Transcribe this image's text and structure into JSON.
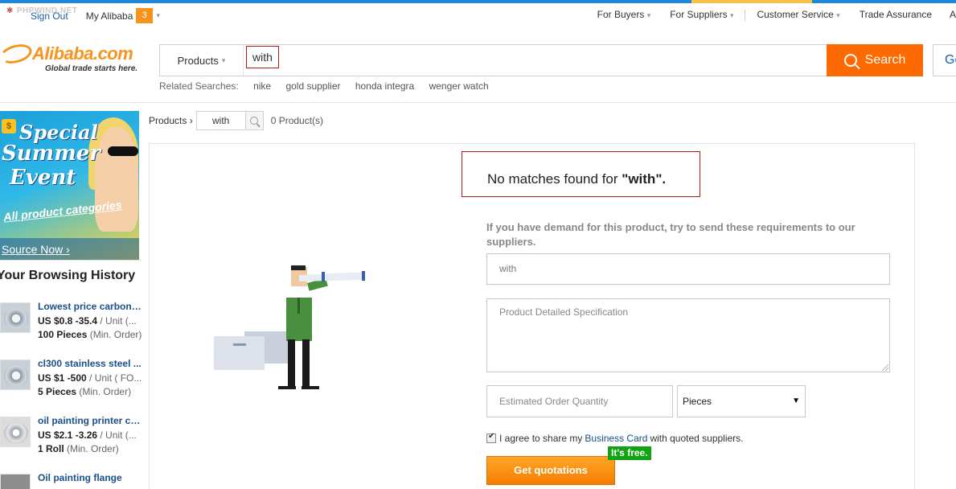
{
  "topnav": {
    "watermark": "PHPWIND.NET",
    "sign_out": "Sign Out",
    "my_alibaba": "My Alibaba",
    "message_count": "3",
    "links": [
      "For Buyers",
      "For Suppliers",
      "Customer Service",
      "Trade Assurance",
      "A"
    ]
  },
  "header": {
    "logo_name": "Alibaba.com",
    "logo_tagline": "Global trade starts here.",
    "search_category": "Products",
    "search_query": "with",
    "search_button": "Search",
    "side_button": "Ge",
    "related_label": "Related Searches:",
    "related": [
      "nike",
      "gold supplier",
      "honda integra",
      "wenger watch"
    ]
  },
  "promo": {
    "line1": "Special",
    "line2": "Summer",
    "line3": "Event",
    "sub": "All product categories",
    "cta": "Source Now ›"
  },
  "history": {
    "title": "Your Browsing History",
    "items": [
      {
        "name": "Lowest price carbon s...",
        "price": "US $0.8 -35.4",
        "unit": "/ Unit (...",
        "moq": "100 Pieces",
        "moq_note": "(Min. Order)"
      },
      {
        "name": "cl300 stainless steel ...",
        "price": "US $1 -500",
        "unit": "/ Unit ( FO...",
        "moq": "5 Pieces",
        "moq_note": "(Min. Order)"
      },
      {
        "name": "oil painting printer ca...",
        "price": "US $2.1 -3.26",
        "unit": "/ Unit (...",
        "moq": "1 Roll",
        "moq_note": "(Min. Order)"
      },
      {
        "name": "Oil painting flange",
        "price": "",
        "unit": "",
        "moq": "",
        "moq_note": ""
      }
    ]
  },
  "results": {
    "crumb": "Products ›",
    "keyword": "with",
    "count": "0 Product(s)",
    "nomatch_prefix": "No matches found for ",
    "nomatch_query": "\"with\".",
    "demand": "If you have demand for this product, try to send these requirements to our suppliers.",
    "product_value": "with",
    "spec_placeholder": "Product Detailed Specification",
    "qty_placeholder": "Estimated Order Quantity",
    "unit_value": "Pieces",
    "agree_prefix": "I agree to share my",
    "agree_link": "Business Card",
    "agree_suffix": "with quoted suppliers.",
    "get_button": "Get quotations",
    "free_badge": "It's free."
  },
  "colors": {
    "accent": "#ff6a00",
    "link": "#1a4f8a",
    "highlight_border": "#b31b1b",
    "free_badge": "#12a312"
  }
}
